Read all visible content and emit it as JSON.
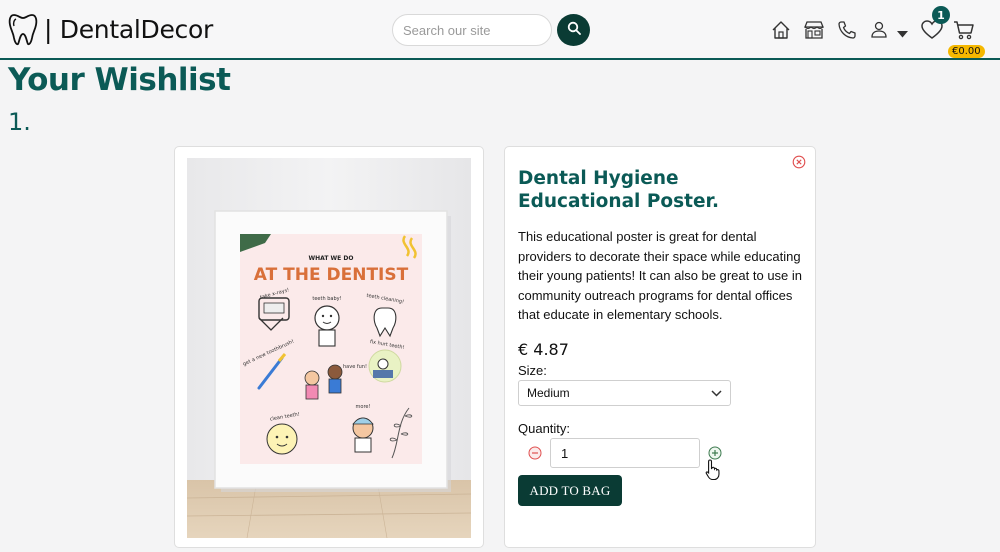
{
  "header": {
    "logo_text": "| DentalDecor",
    "search_placeholder": "Search our site",
    "wishlist_count": "1",
    "cart_total": "€0.00",
    "icons": [
      "tooth-icon",
      "search-icon",
      "home-icon",
      "store-icon",
      "phone-icon",
      "user-icon",
      "caret-down-icon",
      "heart-icon",
      "cart-icon"
    ]
  },
  "page": {
    "title": "Your Wishlist",
    "item_index": "1."
  },
  "product": {
    "title": "Dental Hygiene Educational Poster.",
    "description": "This educational poster is great for dental providers to decorate their space while educating their young patients! It can also be great to use in community outreach programs for dental offices that educate in elementary schools.",
    "price": "€ 4.87",
    "size_label": "Size:",
    "size_selected": "Medium",
    "quantity_label": "Quantity:",
    "quantity_value": "1",
    "add_button": "ADD TO BAG",
    "poster": {
      "heading_small": "WHAT WE DO",
      "heading_large": "AT THE DENTIST",
      "items": [
        "take x-rays!",
        "teeth baby!",
        "teeth cleaning!",
        "get a new toothbrush!",
        "fix hurt teeth!",
        "have fun!",
        "clean teeth!",
        "more!"
      ]
    }
  },
  "colors": {
    "brand": "#0b5a56",
    "button_dark": "#0a3b34",
    "badge_yellow": "#f5b800",
    "remove_red": "#e05050"
  }
}
